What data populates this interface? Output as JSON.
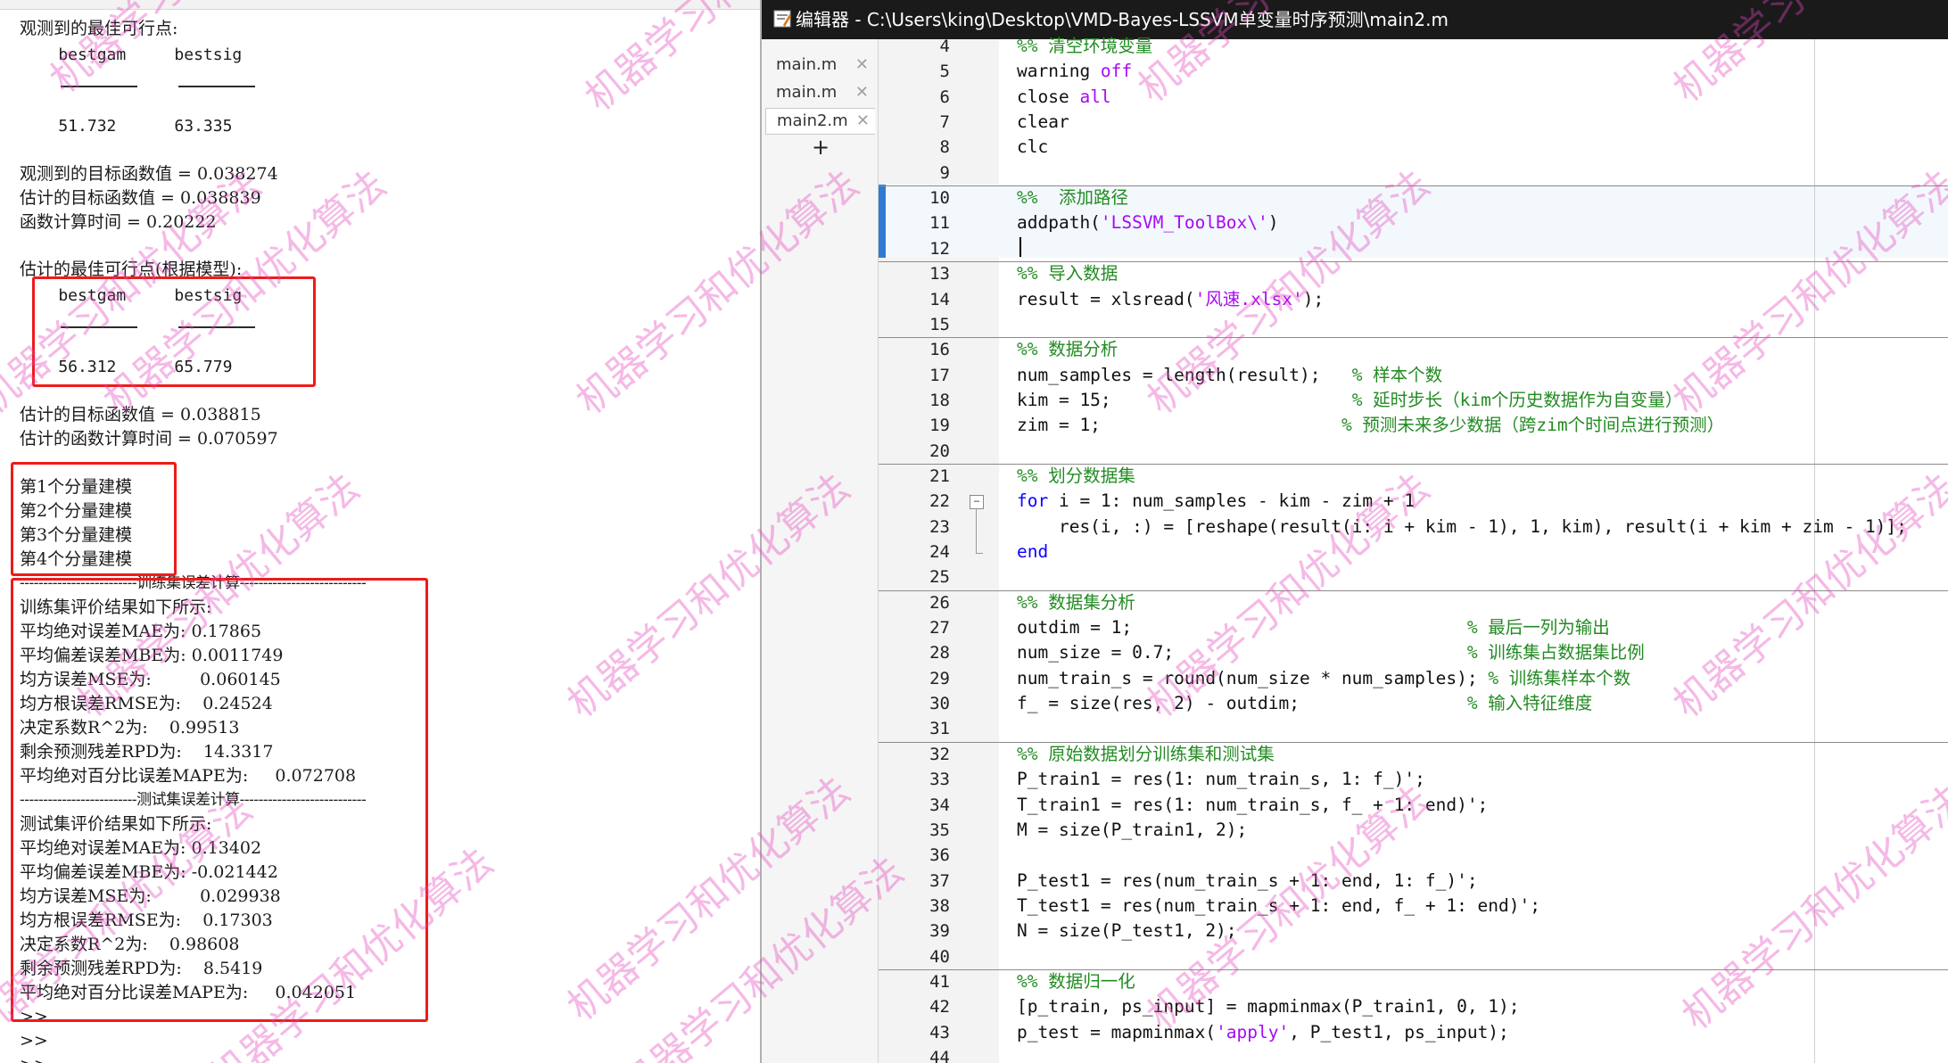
{
  "console": {
    "lines": [
      "观测到的最佳可行点:",
      "    bestgam     bestsig",
      "",
      "    51.732      63.335",
      "观测到的目标函数值 = 0.038274",
      "估计的目标函数值 = 0.038839",
      "函数计算时间 = 0.20222",
      "估计的最佳可行点(根据模型):",
      "    bestgam     bestsig",
      "    56.312      65.779",
      "估计的目标函数值 = 0.038815",
      "估计的函数计算时间 = 0.070597",
      "第1个分量建模",
      "第2个分量建模",
      "第3个分量建模",
      "第4个分量建模",
      "-------------------------训练集误差计算---------------------------",
      "训练集评价结果如下所示:",
      "平均绝对误差MAE为: 0.17865",
      "平均偏差误差MBE为: 0.0011749",
      "均方误差MSE为:         0.060145",
      "均方根误差RMSE为:    0.24524",
      "决定系数R^2为:    0.99513",
      "剩余预测残差RPD为:    14.3317",
      "平均绝对百分比误差MAPE为:     0.072708",
      "-------------------------测试集误差计算---------------------------",
      "测试集评价结果如下所示:",
      "平均绝对误差MAE为: 0.13402",
      "平均偏差误差MBE为: -0.021442",
      "均方误差MSE为:         0.029938",
      "均方根误差RMSE为:    0.17303",
      "决定系数R^2为:    0.98608",
      "剩余预测残差RPD为:    8.5419",
      "平均绝对百分比误差MAPE为:     0.042051",
      ">>",
      ">>",
      ">>"
    ],
    "highlight_color": "#ee1b1b"
  },
  "editor": {
    "title": "编辑器 - C:\\Users\\king\\Desktop\\VMD-Bayes-LSSVM单变量时序预测\\main2.m",
    "tabs": [
      {
        "label": "main.m",
        "close": "✕"
      },
      {
        "label": "main.m",
        "close": "✕"
      },
      {
        "label": "main2.m",
        "close": "✕"
      }
    ],
    "new_tab": "+",
    "fold_symbol": "−",
    "line_numbers": [
      "4",
      "5",
      "6",
      "7",
      "8",
      "9",
      "10",
      "11",
      "12",
      "13",
      "14",
      "15",
      "16",
      "17",
      "18",
      "19",
      "20",
      "21",
      "22",
      "23",
      "24",
      "25",
      "26",
      "27",
      "28",
      "29",
      "30",
      "31",
      "32",
      "33",
      "34",
      "35",
      "36",
      "37",
      "38",
      "39",
      "40",
      "41",
      "42",
      "43",
      "44"
    ],
    "code": [
      [
        {
          "t": "%% 清空环境变量",
          "c": "cm"
        }
      ],
      [
        {
          "t": "warning ",
          "c": ""
        },
        {
          "t": "off",
          "c": "str"
        }
      ],
      [
        {
          "t": "close ",
          "c": ""
        },
        {
          "t": "all",
          "c": "str"
        }
      ],
      [
        {
          "t": "clear",
          "c": ""
        }
      ],
      [
        {
          "t": "clc",
          "c": ""
        }
      ],
      [],
      [
        {
          "t": "%%  添加路径",
          "c": "cm"
        }
      ],
      [
        {
          "t": "addpath(",
          "c": ""
        },
        {
          "t": "'LSSVM_ToolBox\\'",
          "c": "str"
        },
        {
          "t": ")",
          "c": ""
        }
      ],
      [],
      [
        {
          "t": "%% 导入数据",
          "c": "cm"
        }
      ],
      [
        {
          "t": "result = xlsread(",
          "c": ""
        },
        {
          "t": "'风速.xlsx'",
          "c": "str"
        },
        {
          "t": ");",
          "c": ""
        }
      ],
      [],
      [
        {
          "t": "%% 数据分析",
          "c": "cm"
        }
      ],
      [
        {
          "t": "num_samples = length(result);   ",
          "c": ""
        },
        {
          "t": "% 样本个数",
          "c": "cm"
        }
      ],
      [
        {
          "t": "kim = 15;                       ",
          "c": ""
        },
        {
          "t": "% 延时步长（kim个历史数据作为自变量）",
          "c": "cm"
        }
      ],
      [
        {
          "t": "zim = 1;                       ",
          "c": ""
        },
        {
          "t": "% 预测未来多少数据（跨zim个时间点进行预测）",
          "c": "cm"
        }
      ],
      [],
      [
        {
          "t": "%% 划分数据集",
          "c": "cm"
        }
      ],
      [
        {
          "t": "for",
          "c": "kw"
        },
        {
          "t": " i = 1: num_samples - kim - zim + 1",
          "c": ""
        }
      ],
      [
        {
          "t": "    res(i, :) = [reshape(result(i: i + kim - 1), 1, kim), result(i + kim + zim - 1)];",
          "c": ""
        }
      ],
      [
        {
          "t": "end",
          "c": "kw"
        }
      ],
      [],
      [
        {
          "t": "%% 数据集分析",
          "c": "cm"
        }
      ],
      [
        {
          "t": "outdim = 1;                                ",
          "c": ""
        },
        {
          "t": "% 最后一列为输出",
          "c": "cm"
        }
      ],
      [
        {
          "t": "num_size = 0.7;                            ",
          "c": ""
        },
        {
          "t": "% 训练集占数据集比例",
          "c": "cm"
        }
      ],
      [
        {
          "t": "num_train_s = round(num_size * num_samples); ",
          "c": ""
        },
        {
          "t": "% 训练集样本个数",
          "c": "cm"
        }
      ],
      [
        {
          "t": "f_ = size(res, 2) - outdim;                ",
          "c": ""
        },
        {
          "t": "% 输入特征维度",
          "c": "cm"
        }
      ],
      [],
      [
        {
          "t": "%% 原始数据划分训练集和测试集",
          "c": "cm"
        }
      ],
      [
        {
          "t": "P_train1 = res(1: num_train_s, 1: f_)';",
          "c": ""
        }
      ],
      [
        {
          "t": "T_train1 = res(1: num_train_s, f_ + 1: end)';",
          "c": ""
        }
      ],
      [
        {
          "t": "M = size(P_train1, 2);",
          "c": ""
        }
      ],
      [],
      [
        {
          "t": "P_test1 = res(num_train_s + 1: end, 1: f_)';",
          "c": ""
        }
      ],
      [
        {
          "t": "T_test1 = res(num_train_s + 1: end, f_ + 1: end)';",
          "c": ""
        }
      ],
      [
        {
          "t": "N = size(P_test1, 2);",
          "c": ""
        }
      ],
      [],
      [
        {
          "t": "%% 数据归一化",
          "c": "cm"
        }
      ],
      [
        {
          "t": "[p_train, ps_input] = mapminmax(P_train1, 0, 1);",
          "c": ""
        }
      ],
      [
        {
          "t": "p_test = mapminmax(",
          "c": ""
        },
        {
          "t": "'apply'",
          "c": "str"
        },
        {
          "t": ", P_test1, ps_input);",
          "c": ""
        }
      ],
      []
    ]
  },
  "watermark": {
    "text": "机器学习和优化算法",
    "color": "#e446be"
  }
}
